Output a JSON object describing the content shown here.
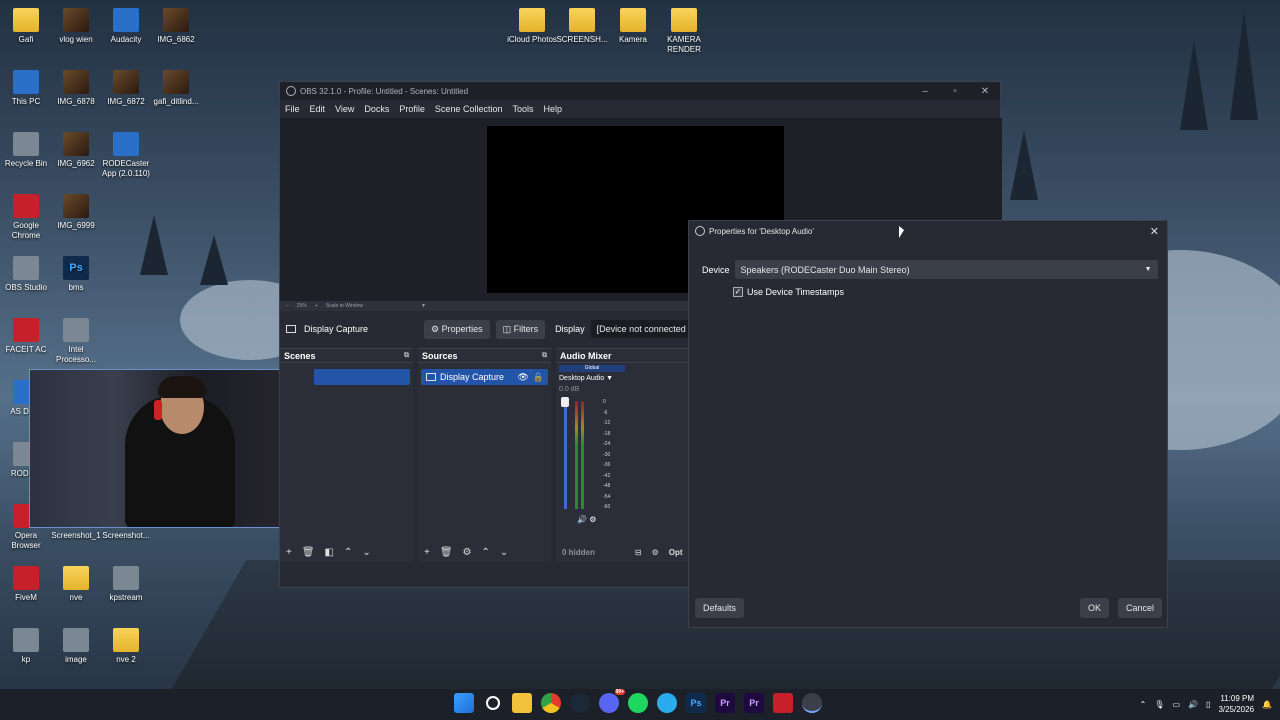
{
  "desktop": {
    "icons": [
      {
        "label": "Gafi",
        "kind": "folder"
      },
      {
        "label": "vlog wien",
        "kind": "photo"
      },
      {
        "label": "Audacity",
        "kind": "app-blue"
      },
      {
        "label": "IMG_6862",
        "kind": "photo"
      },
      {
        "label": "This PC",
        "kind": "app-blue"
      },
      {
        "label": "IMG_6878",
        "kind": "photo"
      },
      {
        "label": "IMG_6872",
        "kind": "photo"
      },
      {
        "label": "gafi_ditlind...",
        "kind": "photo"
      },
      {
        "label": "Recycle Bin",
        "kind": "app-gray"
      },
      {
        "label": "IMG_6962",
        "kind": "photo"
      },
      {
        "label": "RODECaster App (2.0.110)",
        "kind": "app-blue"
      },
      {
        "label": "Google Chrome",
        "kind": "app-red"
      },
      {
        "label": "IMG_6999",
        "kind": "photo"
      },
      {
        "label": "OBS Studio",
        "kind": "app-gray"
      },
      {
        "label": "bms",
        "kind": "app-ps"
      },
      {
        "label": "FACEIT AC",
        "kind": "app-red"
      },
      {
        "label": "Intel Processo...",
        "kind": "app-gray"
      },
      {
        "label": "AS Drive",
        "kind": "app-blue"
      },
      {
        "label": "RODE A",
        "kind": "app-gray"
      },
      {
        "label": "Opera Browser",
        "kind": "app-red"
      },
      {
        "label": "Screenshot_1",
        "kind": "app-gray"
      },
      {
        "label": "Screenshot...",
        "kind": "app-gray"
      },
      {
        "label": "FiveM",
        "kind": "app-red"
      },
      {
        "label": "nve",
        "kind": "folder"
      },
      {
        "label": "kpstream",
        "kind": "app-gray"
      },
      {
        "label": "kp",
        "kind": "app-gray"
      },
      {
        "label": "image",
        "kind": "app-gray"
      },
      {
        "label": "nve 2",
        "kind": "folder"
      },
      {
        "label": "iCloud Photos",
        "kind": "folder"
      },
      {
        "label": "SCREENSH...",
        "kind": "folder"
      },
      {
        "label": "Kamera",
        "kind": "folder"
      },
      {
        "label": "KAMERA RENDER",
        "kind": "folder"
      }
    ],
    "ps_glyph": "Ps"
  },
  "obs": {
    "title": "OBS 32.1.0 - Profile: Untitled - Scenes: Untitled",
    "menu": [
      "File",
      "Edit",
      "View",
      "Docks",
      "Profile",
      "Scene Collection",
      "Tools",
      "Help"
    ],
    "zoom": {
      "minus": "–",
      "value": "25%",
      "plus": "+",
      "mode": "Scale to Window"
    },
    "context": {
      "source_name": "Display Capture",
      "properties_label": "Properties",
      "filters_label": "Filters",
      "display_label": "Display",
      "display_value": "[Device not connected"
    },
    "scenes": {
      "title": "Scenes",
      "selected_index": 0
    },
    "sources": {
      "title": "Sources",
      "items": [
        {
          "label": "Display Capture"
        }
      ]
    },
    "mixer": {
      "title": "Audio Mixer",
      "global_label": "Global",
      "channel_label": "Desktop Audio",
      "volume": "0.0 dB",
      "ticks": [
        "0",
        "-6",
        "-12",
        "-18",
        "-24",
        "-30",
        "-36",
        "-42",
        "-48",
        "-54",
        "-60"
      ],
      "hidden_label": "0 hidden",
      "opt_label": "Opt"
    }
  },
  "dialog": {
    "title": "Properties for 'Desktop Audio'",
    "device_label": "Device",
    "device_value": "Speakers (RODECaster Duo Main Stereo)",
    "timestamps_label": "Use Device Timestamps",
    "timestamps_checked": true,
    "defaults_label": "Defaults",
    "ok_label": "OK",
    "cancel_label": "Cancel"
  },
  "taskbar": {
    "apps": [
      "windows-start",
      "search",
      "file-explorer",
      "chrome",
      "steam",
      "discord",
      "spotify",
      "telegram",
      "photoshop",
      "premiere",
      "premiere-2",
      "acrobat",
      "obs"
    ],
    "ps_glyph": "Ps",
    "pr_glyph": "Pr",
    "time": "11:09 PM",
    "date": "3/25/2026",
    "discord_badge": "99+"
  },
  "colors": {
    "accent": "#2254a8",
    "obs_bg": "#272a33",
    "taskbar": "#1c2028"
  }
}
